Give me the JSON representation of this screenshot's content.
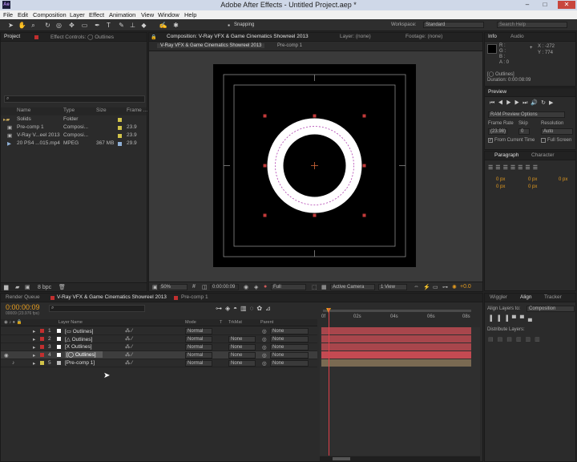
{
  "window": {
    "title": "Adobe After Effects - Untitled Project.aep *",
    "app_badge": "Ae",
    "minimize": "–",
    "maximize": "□",
    "close": "✕"
  },
  "menu": [
    "File",
    "Edit",
    "Composition",
    "Layer",
    "Effect",
    "Animation",
    "View",
    "Window",
    "Help"
  ],
  "toolbar": {
    "snapping": "Snapping",
    "workspace_label": "Workspace:",
    "workspace_value": "Standard",
    "search_placeholder": "Search Help"
  },
  "project": {
    "tabs": [
      "Project",
      "Effect Controls: ◯ Outlines"
    ],
    "columns": [
      "Name",
      "Type",
      "Size",
      "Frame ..."
    ],
    "items": [
      {
        "name": "Solids",
        "type": "Folder",
        "size": "",
        "fps": "",
        "label": "#d2c44a"
      },
      {
        "name": "Pre-comp 1",
        "type": "Composi...",
        "size": "",
        "fps": "23.9",
        "label": "#d2c44a"
      },
      {
        "name": "V-Ray V...eel 2013",
        "type": "Composi...",
        "size": "",
        "fps": "23.9",
        "label": "#d2c44a"
      },
      {
        "name": "20 PS4 ...015.mp4",
        "type": "MPEG",
        "size": "367 MB",
        "fps": "29.9",
        "label": "#8fb0d6"
      }
    ],
    "bpc": "8 bpc"
  },
  "composition": {
    "tab": "Composition: V-Ray VFX & Game Cinematics Showreel 2013",
    "layer_tab": "Layer: (none)",
    "footage_tab": "Footage: (none)",
    "breadcrumbs": [
      "V-Ray VFX & Game Cinematics Showreel 2013",
      "Pre-comp 1"
    ],
    "zoom": "50%",
    "timecode": "0:00:00:09",
    "resolution": "Full",
    "camera": "Active Camera",
    "view": "1 View",
    "exposure": "+0.0"
  },
  "info": {
    "tabs": [
      "Info",
      "Audio"
    ],
    "r": "R :",
    "g": "G :",
    "b": "B :",
    "a": "A : 0",
    "x": "X : -272",
    "y": "Y : 774",
    "layer_name": "[◯ Outlines]",
    "duration": "Duration: 0:00:08:09"
  },
  "preview": {
    "tab": "Preview",
    "mode": "RAM Preview Options",
    "frame_rate_label": "Frame Rate",
    "skip_label": "Skip",
    "resolution_label": "Resolution",
    "frame_rate": "(23.98)",
    "skip": "0",
    "resolution": "Auto",
    "from_current": "From Current Time",
    "full_screen": "Full Screen"
  },
  "paragraph": {
    "tabs": [
      "Paragraph",
      "Character"
    ],
    "px_values": [
      "0 px",
      "0 px",
      "0 px",
      "0 px",
      "0 px"
    ]
  },
  "timeline": {
    "tabs": [
      "Render Queue",
      "V-Ray VFX & Game Cinematics Showreel 2013",
      "Pre-comp 1"
    ],
    "timecode": "0:00:00:09",
    "fps_note": "00009 (23.976 fps)",
    "columns": {
      "name": "Layer Name",
      "mode": "Mode",
      "t": "T",
      "trkmat": "TrkMat",
      "parent": "Parent"
    },
    "ruler": [
      "0f",
      "02s",
      "04s",
      "06s",
      "08s"
    ],
    "layers": [
      {
        "num": "1",
        "name": "[▭ Outlines]",
        "mode": "Normal",
        "trkmat": "",
        "parent": "None",
        "color": "#c22f2f"
      },
      {
        "num": "2",
        "name": "[△ Outlines]",
        "mode": "Normal",
        "trkmat": "None",
        "parent": "None",
        "color": "#c22f2f"
      },
      {
        "num": "3",
        "name": "[X Outlines]",
        "mode": "Normal",
        "trkmat": "None",
        "parent": "None",
        "color": "#c22f2f"
      },
      {
        "num": "4",
        "name": "[◯ Outlines]",
        "mode": "Normal",
        "trkmat": "None",
        "parent": "None",
        "color": "#c22f2f"
      },
      {
        "num": "5",
        "name": "[Pre-comp 1]",
        "mode": "Normal",
        "trkmat": "None",
        "parent": "None",
        "color": "#d2c44a"
      }
    ]
  },
  "align": {
    "tabs": [
      "Wiggler",
      "Align",
      "Tracker"
    ],
    "align_to_label": "Align Layers to:",
    "align_to_value": "Composition",
    "distribute_label": "Distribute Layers:"
  },
  "colors": {
    "accent": "#e49b1f",
    "layer_red": "#c22f2f",
    "track_red": "#a8464c",
    "track_tan": "#7a6a52"
  }
}
